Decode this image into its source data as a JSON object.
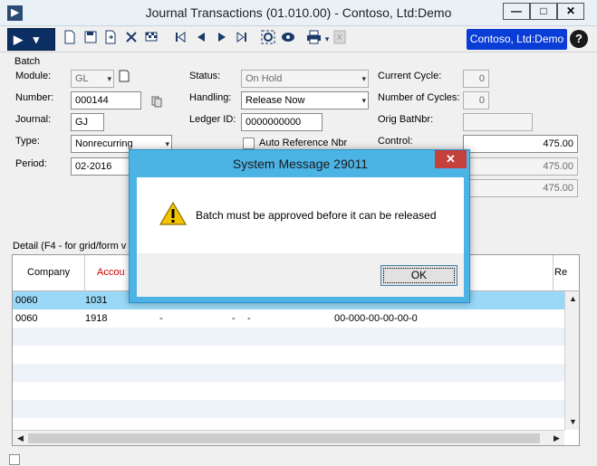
{
  "window": {
    "title": "Journal Transactions (01.010.00) - Contoso, Ltd:Demo",
    "app_icon": "▶",
    "minimize": "—",
    "maximize": "□",
    "close": "✕"
  },
  "toolbar": {
    "logo_arrow": "▶",
    "logo_chevron": "▾",
    "company": "Contoso, Ltd:Demo",
    "help": "?",
    "icons": [
      "new-icon",
      "save-icon",
      "copy-icon",
      "delete-icon",
      "finish-icon",
      "first-icon",
      "previous-icon",
      "next-icon",
      "last-icon",
      "refresh-icon",
      "view-icon",
      "print-icon",
      "excel-icon"
    ]
  },
  "batch": {
    "group_label": "Batch",
    "module_label": "Module:",
    "module_value": "GL",
    "number_label": "Number:",
    "number_value": "000144",
    "journal_label": "Journal:",
    "journal_value": "GJ",
    "type_label": "Type:",
    "type_value": "Nonrecurring",
    "period_label": "Period:",
    "period_value": "02-2016",
    "status_label": "Status:",
    "status_value": "On Hold",
    "handling_label": "Handling:",
    "handling_value": "Release Now",
    "ledger_label": "Ledger ID:",
    "ledger_value": "0000000000",
    "auto_ref_label": "Auto Reference Nbr",
    "current_cycle_label": "Current Cycle:",
    "current_cycle_value": "0",
    "num_cycles_label": "Number of Cycles:",
    "num_cycles_value": "0",
    "orig_batnbr_label": "Orig BatNbr:",
    "orig_batnbr_value": "",
    "control_label": "Control:",
    "control_value": "475.00",
    "debit_value": "475.00",
    "credit_value": "475.00"
  },
  "detail": {
    "label": "Detail (F4 - for grid/form v",
    "columns": [
      "Company",
      "Accou",
      "Re"
    ],
    "rows": [
      {
        "company": "0060",
        "account": "1031",
        "c3": "",
        "c4": "",
        "c5": "",
        "c6": "",
        "selected": true
      },
      {
        "company": "0060",
        "account": "1918",
        "c3": "-",
        "c4": "-",
        "c5": "-",
        "c6": "00-000-00-00-00-0",
        "selected": false
      }
    ]
  },
  "dialog": {
    "title": "System Message 29011",
    "close": "✕",
    "message": "Batch must be approved before it can be released",
    "ok": "OK",
    "icon": "warning-icon"
  },
  "colors": {
    "accent": "#0a3dd6",
    "dialog_frame": "#4cb3e5",
    "selected_row": "#99d9f7",
    "alt_row": "#eef3fa",
    "required_header": "#cc0000"
  }
}
